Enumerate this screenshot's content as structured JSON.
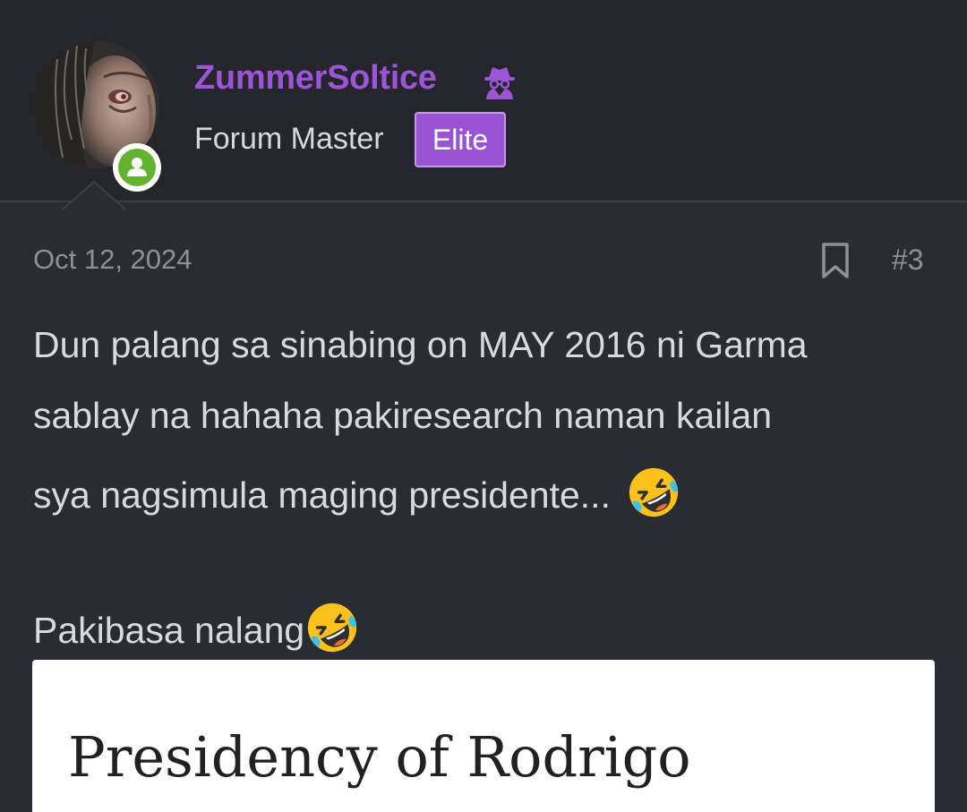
{
  "post": {
    "author": {
      "username": "ZummerSoltice",
      "username_icon": "spy-icon",
      "role": "Forum Master",
      "badge": "Elite",
      "online_status_icon": "user-online-icon"
    },
    "date": "Oct 12, 2024",
    "bookmark_icon": "bookmark-icon",
    "number": "#3",
    "body_lines": [
      "Dun palang sa sinabing on MAY 2016 ni Garma",
      "sablay na hahaha pakiresearch naman kailan",
      "sya nagsimula maging presidente..."
    ],
    "second_paragraph": "Pakibasa nalang",
    "emoji": "rolling-on-floor-laughing-emoji",
    "embedded_image": {
      "title": "Presidency of Rodrigo"
    }
  },
  "colors": {
    "background": "#2a2c33",
    "header_background": "#24262c",
    "username": "#9b55d6",
    "badge": "#9a53d3",
    "online": "#63b32e"
  }
}
